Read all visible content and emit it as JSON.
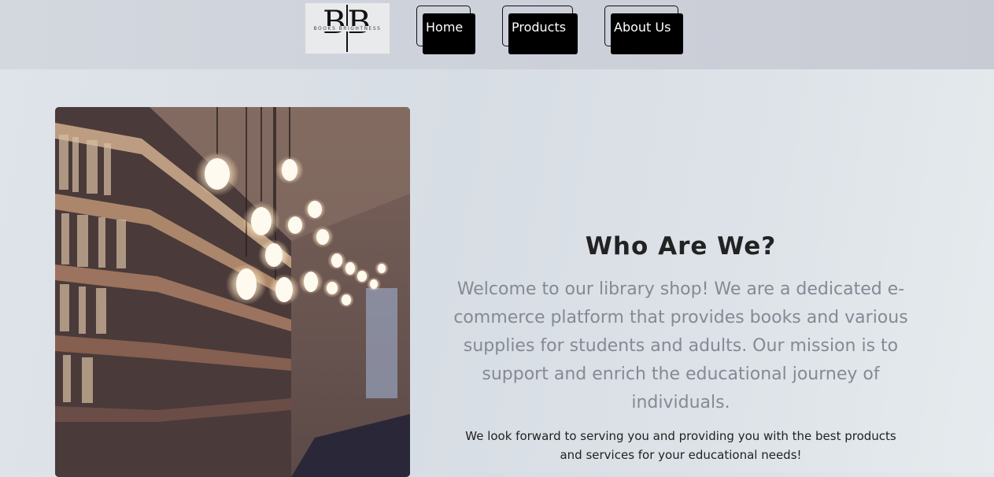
{
  "brand": {
    "logo_monogram": "B|B",
    "logo_tagline": "BOOKS BRIGHTNESS"
  },
  "nav": {
    "items": [
      {
        "label": "Home"
      },
      {
        "label": "Products"
      },
      {
        "label": "About Us"
      }
    ]
  },
  "hero": {
    "image_icon": "library-photo"
  },
  "about": {
    "title": "Who Are We?",
    "description": "Welcome to our library shop! We are a dedicated e-commerce platform that provides books and various supplies for students and adults. Our mission is to support and enrich the educational journey of individuals.",
    "note": "We look forward to serving you and providing you with the best products and services for your educational needs!"
  },
  "colors": {
    "nav_button": "#000000",
    "title": "#222222",
    "description": "#858995"
  }
}
